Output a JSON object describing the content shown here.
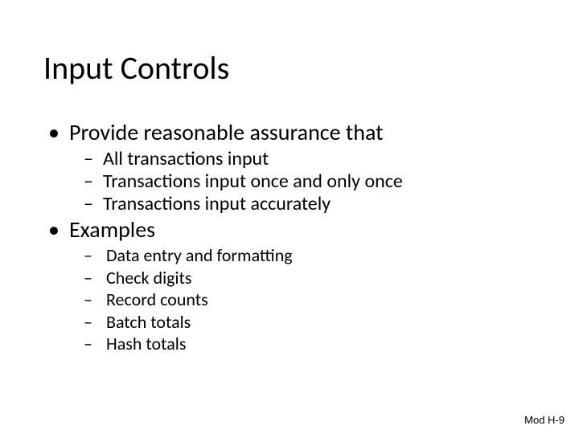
{
  "title": "Input Controls",
  "bullets": [
    {
      "text": "Provide reasonable assurance that",
      "sub": [
        "All transactions input",
        "Transactions input once and only once",
        "Transactions input accurately"
      ],
      "subStyle": "a"
    },
    {
      "text": "Examples",
      "sub": [
        "Data entry and formatting",
        "Check digits",
        "Record counts",
        "Batch totals",
        "Hash totals"
      ],
      "subStyle": "b"
    }
  ],
  "footer": "Mod H-9"
}
